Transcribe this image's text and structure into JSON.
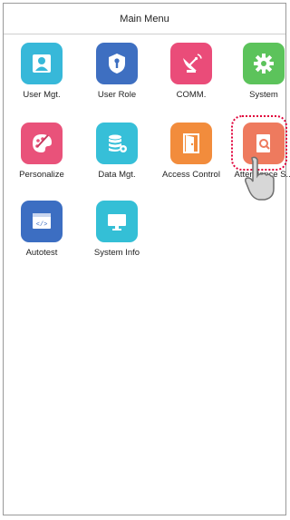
{
  "header": {
    "title": "Main Menu"
  },
  "menu": {
    "items": [
      {
        "label": "User Mgt.",
        "icon": "user-icon",
        "color": "#37B8D9"
      },
      {
        "label": "User Role",
        "icon": "shield-icon",
        "color": "#3E6FC1"
      },
      {
        "label": "COMM.",
        "icon": "satellite-dish-icon",
        "color": "#EA4C79"
      },
      {
        "label": "System",
        "icon": "gear-icon",
        "color": "#5CC35B"
      },
      {
        "label": "Personalize",
        "icon": "palette-icon",
        "color": "#E9527A"
      },
      {
        "label": "Data Mgt.",
        "icon": "database-icon",
        "color": "#36BFD8"
      },
      {
        "label": "Access Control",
        "icon": "door-icon",
        "color": "#F28C3C"
      },
      {
        "label": "Attendance Search",
        "label_visible": "Attendance S...",
        "icon": "search-document-icon",
        "color": "#EE7A5E"
      },
      {
        "label": "Autotest",
        "icon": "code-window-icon",
        "color": "#3C6EC2"
      },
      {
        "label": "System Info",
        "icon": "monitor-icon",
        "color": "#34BFD6"
      }
    ]
  }
}
